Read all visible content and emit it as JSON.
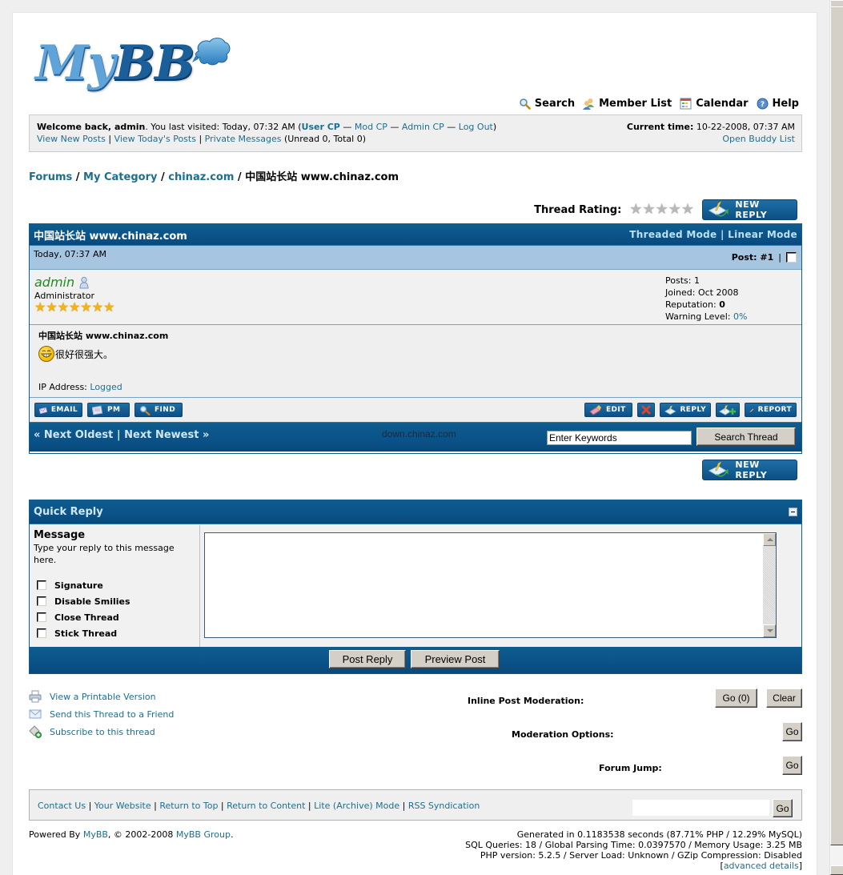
{
  "logo": {
    "my": "My",
    "bb": "BB"
  },
  "top_menu": [
    {
      "label": "Search",
      "icon": "search-icon"
    },
    {
      "label": "Member List",
      "icon": "members-icon"
    },
    {
      "label": "Calendar",
      "icon": "calendar-icon"
    },
    {
      "label": "Help",
      "icon": "help-icon"
    }
  ],
  "welcome": {
    "greeting": "Welcome back, admin",
    "last_visited": ". You last visited: Today, 07:32 AM (",
    "user_cp": "User CP",
    "mod_cp": "Mod CP",
    "admin_cp": "Admin CP",
    "log_out": "Log Out",
    "sep": " — ",
    "close_paren": ")",
    "view_new_posts": "View New Posts",
    "view_todays_posts": "View Today's Posts",
    "private_messages": "Private Messages",
    "pm_counts": " (Unread 0, Total 0)",
    "current_time_label": "Current time:",
    "current_time_value": " 10-22-2008, 07:37 AM",
    "open_buddy_list": "Open Buddy List"
  },
  "breadcrumb": {
    "items": [
      "Forums",
      "My Category",
      "chinaz.com"
    ],
    "active": "中国站长站  www.chinaz.com",
    "sep": " / "
  },
  "thread": {
    "rating_label": "Thread Rating:",
    "rating_stars": 0,
    "rating_max": 5,
    "new_reply_label": "NEW REPLY",
    "title": "中国站长站  www.chinaz.com",
    "threaded_mode": "Threaded Mode",
    "linear_mode": "Linear Mode",
    "mode_sep": " | "
  },
  "post": {
    "date": "Today, 07:37 AM",
    "post_number_label": "Post: #1",
    "post_number_sep": "|",
    "author": "admin",
    "author_title": "Administrator",
    "author_stars": 7,
    "stats": {
      "posts": "Posts: 1",
      "joined": "Joined: Oct 2008",
      "reputation_label": "Reputation: ",
      "reputation_value": "0",
      "warning_label": "Warning Level: ",
      "warning_value": "0%"
    },
    "subject": "中国站长站  www.chinaz.com",
    "message": "很好很强大。",
    "ip_label": "IP Address: ",
    "ip_value": "Logged",
    "buttons_left": [
      "EMAIL",
      "PM",
      "FIND"
    ],
    "buttons_right": {
      "edit": "EDIT",
      "reply": "REPLY",
      "report": "REPORT"
    }
  },
  "thread_footer": {
    "next_oldest": "« Next Oldest",
    "sep": " | ",
    "next_newest": "Next Newest »",
    "watermark": "down.chinaz.com",
    "search_placeholder": "Enter Keywords",
    "search_button": "Search Thread"
  },
  "quick_reply": {
    "title": "Quick Reply",
    "message_label": "Message",
    "message_hint": "Type your reply to this message here.",
    "options": [
      "Signature",
      "Disable Smilies",
      "Close Thread",
      "Stick Thread"
    ],
    "post_reply": "Post Reply",
    "preview_post": "Preview Post"
  },
  "tools": [
    {
      "label": "View a Printable Version",
      "icon": "printer-icon"
    },
    {
      "label": "Send this Thread to a Friend",
      "icon": "envelope-icon"
    },
    {
      "label": "Subscribe to this thread",
      "icon": "subscribe-icon"
    }
  ],
  "moderation": {
    "inline_label": "Inline Post Moderation:",
    "go_count": "Go (0)",
    "clear": "Clear",
    "options_label": "Moderation Options:",
    "go": "Go",
    "forum_jump_label": "Forum Jump:"
  },
  "footer": {
    "links": [
      "Contact Us",
      "Your Website",
      "Return to Top",
      "Return to Content",
      "Lite (Archive) Mode",
      "RSS Syndication"
    ],
    "sep": " | ",
    "go": "Go",
    "powered_by": "Powered By ",
    "mybb": "MyBB",
    "copyright": ", © 2002-2008 ",
    "mybb_group": "MyBB Group",
    "period": ".",
    "debug": [
      "Generated in 0.1183538 seconds (87.71% PHP / 12.29% MySQL)",
      "SQL Queries: 18 / Global Parsing Time: 0.0397570 / Memory Usage: 3.25 MB",
      "PHP version: 5.2.5 / Server Load: Unknown / GZip Compression: Disabled"
    ],
    "advanced_open": "[",
    "advanced_details": "advanced details",
    "advanced_close": "]"
  },
  "colors": {
    "accent": "#0F5C8E",
    "link": "#1D6F8F",
    "tcat": "#A5C5E1",
    "panel": "#EFEFEF",
    "author_green": "#1F8E1F"
  }
}
